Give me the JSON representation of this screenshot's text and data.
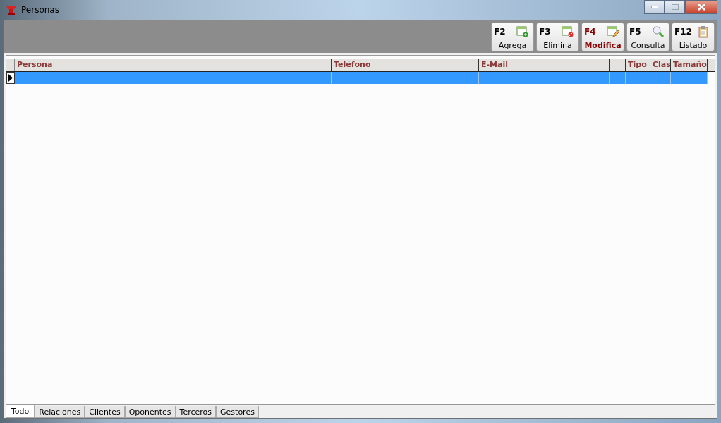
{
  "window": {
    "title": "Personas"
  },
  "toolbar": [
    {
      "key": "F2",
      "label": "Agrega",
      "kind": "add",
      "highlighted": false
    },
    {
      "key": "F3",
      "label": "Elimina",
      "kind": "delete",
      "highlighted": false
    },
    {
      "key": "F4",
      "label": "Modifica",
      "kind": "edit",
      "highlighted": true
    },
    {
      "key": "F5",
      "label": "Consulta",
      "kind": "search",
      "highlighted": false
    },
    {
      "key": "F12",
      "label": "Listado",
      "kind": "list",
      "highlighted": false
    }
  ],
  "table": {
    "columns": [
      {
        "label": "Persona"
      },
      {
        "label": "Teléfono"
      },
      {
        "label": "E-Mail"
      },
      {},
      {
        "label": "Tipo"
      },
      {
        "label": "Clas"
      },
      {
        "label": "Tamaño"
      }
    ],
    "rows": [
      {
        "selected": true
      }
    ]
  },
  "tabs": [
    {
      "label": "Todo",
      "selected": true
    },
    {
      "label": "Relaciones",
      "selected": false
    },
    {
      "label": "Clientes",
      "selected": false
    },
    {
      "label": "Oponentes",
      "selected": false
    },
    {
      "label": "Terceros",
      "selected": false
    },
    {
      "label": "Gestores",
      "selected": false
    }
  ]
}
